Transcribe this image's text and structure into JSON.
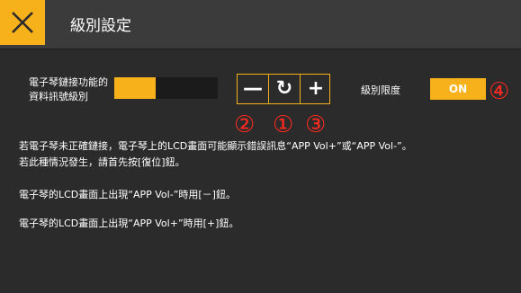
{
  "header": {
    "title": "級別設定"
  },
  "level": {
    "label_line1": "電子琴鏈接功能的",
    "label_line2": "資料訊號級別",
    "fraction": 0.4
  },
  "stepper": {
    "minus": "—",
    "reset": "↻",
    "plus": "+"
  },
  "limit": {
    "label": "級別限度",
    "toggle": "ON"
  },
  "callouts": [
    "②",
    "①",
    "③",
    "④"
  ],
  "body": {
    "line1": "若電子琴未正確鏈接，電子琴上的LCD畫面可能顯示錯誤訊息“APP Vol+”或“APP Vol-”。",
    "line2": "若此種情況發生，請首先按[復位]鈕。",
    "line3": "電子琴的LCD畫面上出現“APP Vol-”時用[－]鈕。",
    "line4": "電子琴的LCD畫面上出現“APP Vol+”時用[+]鈕。"
  },
  "colors": {
    "accent": "#f7b21b",
    "callout": "#ff2a1f",
    "background": "#2b2b2b"
  },
  "icons": {
    "close": "close-icon",
    "reset": "reset-icon",
    "minus": "minus-icon",
    "plus": "plus-icon"
  }
}
